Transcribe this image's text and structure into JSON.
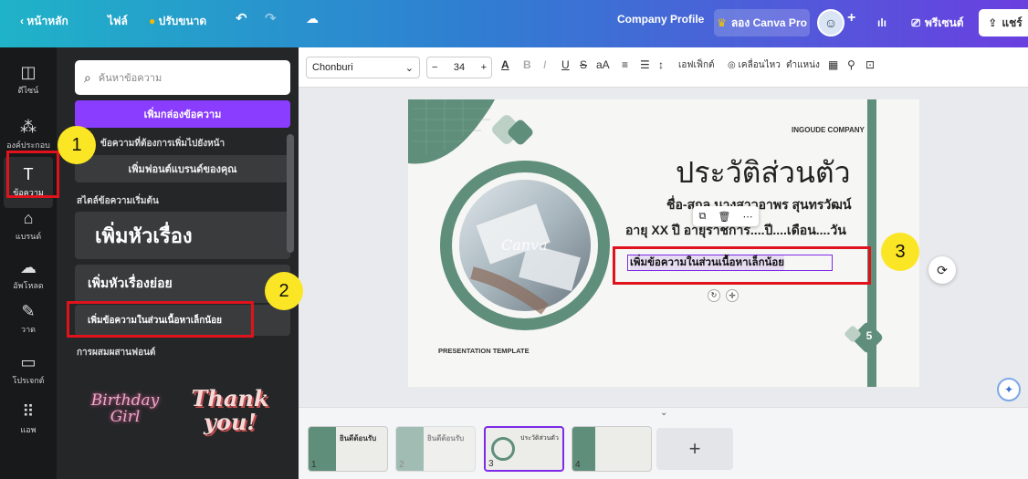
{
  "topbar": {
    "back_label": "หน้าหลัก",
    "file_label": "ไฟล์",
    "resize_label": "ปรับขนาด",
    "doc_title": "Company Profile",
    "try_pro_label": "ลอง Canva Pro",
    "present_label": "พรีเซนต์",
    "share_label": "แชร์"
  },
  "rail": {
    "items": [
      {
        "label": "ดีไซน์",
        "icon": "layout-icon"
      },
      {
        "label": "องค์ประกอบ",
        "icon": "elements-icon"
      },
      {
        "label": "ข้อความ",
        "icon": "text-icon"
      },
      {
        "label": "แบรนด์",
        "icon": "brand-icon"
      },
      {
        "label": "อัพโหลด",
        "icon": "upload-icon"
      },
      {
        "label": "วาด",
        "icon": "draw-icon"
      },
      {
        "label": "โปรเจกต์",
        "icon": "folder-icon"
      },
      {
        "label": "แอพ",
        "icon": "apps-icon"
      }
    ]
  },
  "panel": {
    "search_placeholder": "ค้นหาข้อความ",
    "add_textbox": "เพิ่มกล่องข้อความ",
    "brand_note": "ข้อความที่ต้องการเพิ่มไปยังหน้า",
    "add_brand_font": "เพิ่มฟอนต์แบรนด์ของคุณ",
    "default_styles": "สไตล์ข้อความเริ่มต้น",
    "add_heading": "เพิ่มหัวเรื่อง",
    "add_subheading": "เพิ่มหัวเรื่องย่อย",
    "add_body": "เพิ่มข้อความในส่วนเนื้อหาเล็กน้อย",
    "font_combos": "การผสมผสานฟอนต์",
    "sample1": "Birthday Girl",
    "sample2": "Thank you!"
  },
  "toolbar": {
    "font": "Chonburi",
    "size": "34",
    "effects": "เอฟเฟ็กต์",
    "animate": "เคลื่อนไหว",
    "position": "ตำแหน่ง"
  },
  "slide": {
    "company": "INGOUDE COMPANY",
    "title": "ประวัติส่วนตัว",
    "name_line": "ชื่อ-สกุล นางสาวอาพร สุนทรวัฒน์",
    "age_line": "อายุ XX ปี อายุราชการ....ปี....เดือน....วัน",
    "selected_text": "เพิ่มข้อความในส่วนเนื้อหาเล็กน้อย",
    "template_label": "PRESENTATION TEMPLATE",
    "page_number": "5",
    "watermark": "Canva"
  },
  "thumbs": [
    {
      "num": "1",
      "title": "ยินดีต้อนรับ"
    },
    {
      "num": "2",
      "title": "ยินดีต้อนรับ"
    },
    {
      "num": "3",
      "title": "ประวัติส่วนตัว"
    },
    {
      "num": "4",
      "title": ""
    }
  ],
  "add_page": "+",
  "markers": [
    "1",
    "2",
    "3"
  ],
  "colors": {
    "accent_green": "#5f8f7a",
    "purple": "#7d2ae8",
    "red_highlight": "#e0131c",
    "marker_yellow": "#fbe625"
  }
}
